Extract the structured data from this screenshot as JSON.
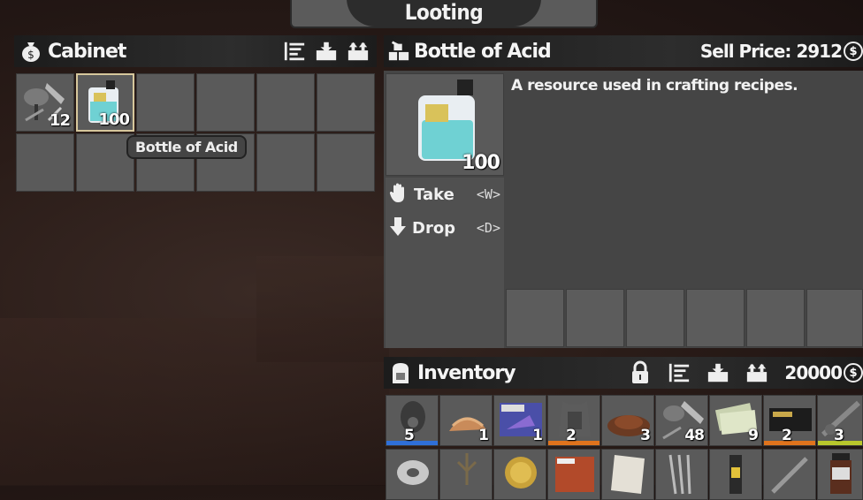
{
  "window": {
    "title": "Looting"
  },
  "container": {
    "title": "Cabinet",
    "icons": [
      "money-bag-icon",
      "sort-icon",
      "place-items-icon",
      "take-all-icon"
    ],
    "slots": [
      {
        "name": "salvage-items",
        "count": "12"
      },
      {
        "name": "bottle-of-acid",
        "count": "100",
        "selected": true
      }
    ],
    "tooltip": "Bottle of Acid"
  },
  "details": {
    "title": "Bottle of Acid",
    "sell_label": "Sell Price:",
    "sell_price": "2912",
    "currency_symbol": "$",
    "count": "100",
    "description": "A resource used in crafting recipes.",
    "actions": [
      {
        "label": "Take",
        "key": "<W>",
        "icon": "hand-icon"
      },
      {
        "label": "Drop",
        "key": "<D>",
        "icon": "arrow-down-icon"
      }
    ]
  },
  "inventory": {
    "title": "Inventory",
    "money": "20000",
    "currency_symbol": "$",
    "icons": [
      "lock-icon",
      "sort-icon",
      "place-items-icon",
      "take-all-icon"
    ],
    "row1": [
      {
        "count": "5",
        "bar": "#2f6fd8"
      },
      {
        "count": "1",
        "bar": ""
      },
      {
        "count": "1",
        "bar": ""
      },
      {
        "count": "2",
        "bar": "#e0731d"
      },
      {
        "count": "3",
        "bar": ""
      },
      {
        "count": "48",
        "bar": ""
      },
      {
        "count": "9",
        "bar": ""
      },
      {
        "count": "2",
        "bar": "#e0731d"
      },
      {
        "count": "3",
        "bar": "#b9c62c"
      }
    ]
  }
}
